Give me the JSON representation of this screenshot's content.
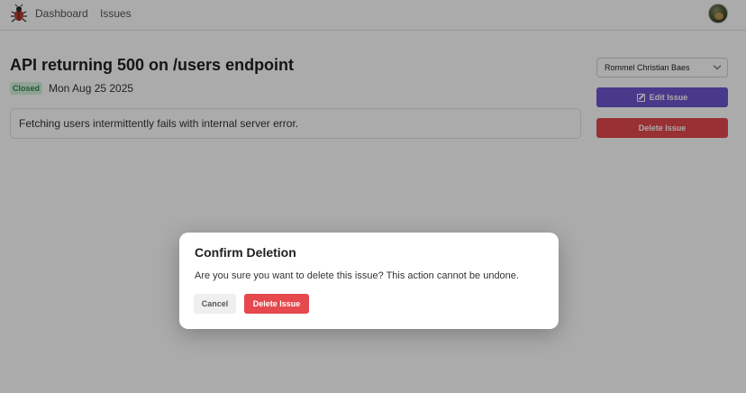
{
  "nav": {
    "links": [
      "Dashboard",
      "Issues"
    ],
    "logo_icon": "bug-icon",
    "avatar_icon": "user-avatar"
  },
  "issue": {
    "title": "API returning 500 on /users endpoint",
    "status": "Closed",
    "date": "Mon Aug 25 2025",
    "description": "Fetching users intermittently fails with internal server error."
  },
  "sidebar": {
    "assignee": "Rommel Christian Baes",
    "edit_label": "Edit Issue",
    "delete_label": "Delete Issue"
  },
  "dialog": {
    "title": "Confirm Deletion",
    "message": "Are you sure you want to delete this issue? This action cannot be undone.",
    "cancel_label": "Cancel",
    "confirm_label": "Delete Issue"
  },
  "colors": {
    "primary": "#6e56cf",
    "danger": "#e5484d",
    "status_closed_bg": "#d6f2de",
    "status_closed_text": "#2f8a4c"
  }
}
